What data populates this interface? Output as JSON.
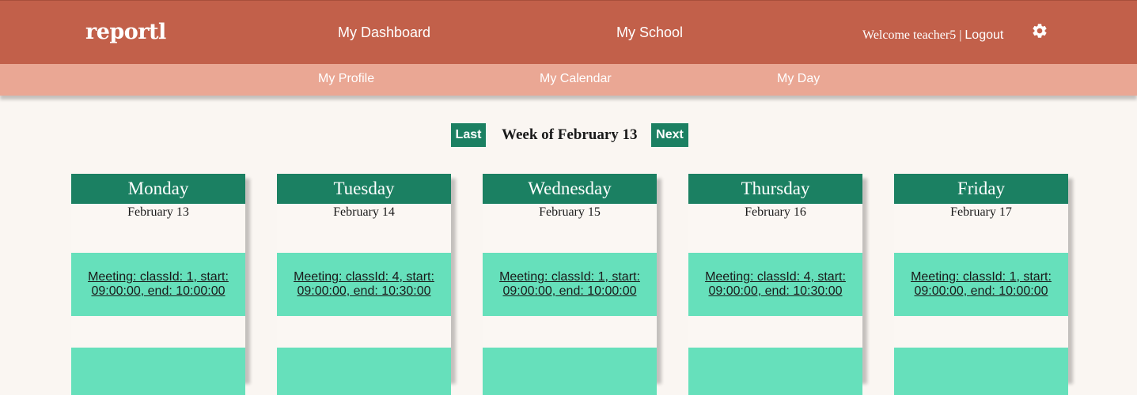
{
  "header": {
    "logo": "reportl",
    "nav": {
      "dashboard": "My Dashboard",
      "school": "My School"
    },
    "welcome": "Welcome teacher5",
    "separator": "|",
    "logout": "Logout",
    "settings_icon": "gear-icon"
  },
  "subnav": {
    "profile": "My Profile",
    "calendar": "My Calendar",
    "day": "My Day"
  },
  "week_nav": {
    "last": "Last",
    "title": "Week of February 13",
    "next": "Next"
  },
  "days": [
    {
      "name": "Monday",
      "date": "February 13",
      "event_line1": "Meeting: classId: 1, start:",
      "event_line2": "09:00:00, end: 10:00:00"
    },
    {
      "name": "Tuesday",
      "date": "February 14",
      "event_line1": "Meeting: classId: 4, start:",
      "event_line2": "09:00:00, end: 10:30:00"
    },
    {
      "name": "Wednesday",
      "date": "February 15",
      "event_line1": "Meeting: classId: 1, start:",
      "event_line2": "09:00:00, end: 10:00:00"
    },
    {
      "name": "Thursday",
      "date": "February 16",
      "event_line1": "Meeting: classId: 4, start:",
      "event_line2": "09:00:00, end: 10:30:00"
    },
    {
      "name": "Friday",
      "date": "February 17",
      "event_line1": "Meeting: classId: 1, start:",
      "event_line2": "09:00:00, end: 10:00:00"
    }
  ],
  "colors": {
    "header": "#c2604a",
    "subnav": "#eaa794",
    "accent_green": "#1b8062",
    "event_green": "#66e0bb",
    "background": "#faf6f2"
  }
}
